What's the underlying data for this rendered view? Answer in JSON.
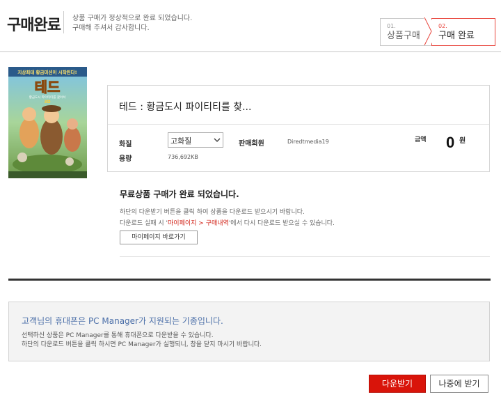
{
  "header": {
    "title": "구매완료",
    "message_line1": "상품 구매가 정상적으로 완료 되었습니다.",
    "message_line2": "구매해 주셔서 감사합니다."
  },
  "steps": [
    {
      "num": "01.",
      "label": "상품구매",
      "active": false
    },
    {
      "num": "02.",
      "label": "구매 완료",
      "active": true
    }
  ],
  "poster": {
    "tagline": "지상최대 황금미션이 시작된다!",
    "logo_text": "테드",
    "subtitle": "황금도시 파이티티를 찾아서",
    "badge": "3D"
  },
  "product": {
    "title": "테드 : 황금도시 파이티티를 찾...",
    "quality_label": "화질",
    "quality_value": "고화질",
    "seller_label": "판매회원",
    "seller_value": "Diredtmedia19",
    "size_label": "용량",
    "size_value": "736,692KB",
    "price_label": "금액",
    "price_value": "0",
    "price_unit": "원"
  },
  "completion": {
    "title": "무료상품 구매가 완료 되었습니다.",
    "msg1": "하단의 다운받기 버튼을 클릭 하여 상품을 다운로드 받으시기 바랍니다.",
    "msg2_prefix": "다운로드 실패 시 '",
    "msg2_highlight": "마이페이지 > 구매내역",
    "msg2_suffix": "'에서 다시 다운로드 받으실 수 있습니다.",
    "mypage_button": "마이페이지 바로가기"
  },
  "pc_manager": {
    "title": "고객님의 휴대폰은 PC Manager가 지원되는 기종입니다.",
    "msg1": "선택하신 상품은 PC Manager를 통해 휴대폰으로 다운받을 수 있습니다.",
    "msg2": "하단의 다운로드 버튼을 클릭 하시면 PC Manager가 실행되니, 창을 닫지 마시기 바랍니다."
  },
  "buttons": {
    "download": "다운받기",
    "later": "나중에 받기"
  },
  "colors": {
    "accent_red": "#d9140a",
    "pc_title_blue": "#4a6ea8"
  }
}
